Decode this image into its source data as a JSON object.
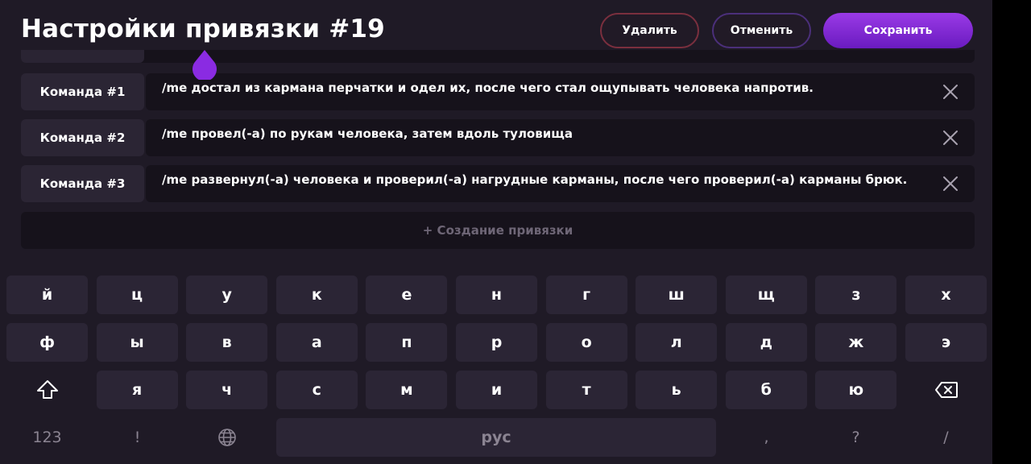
{
  "header": {
    "title": "Настройки привязки #19",
    "delete_label": "Удалить",
    "cancel_label": "Отменить",
    "save_label": "Сохранить"
  },
  "commands": [
    {
      "label": "Команда #1",
      "text": "/me достал из кармана перчатки и одел их, после чего стал ощупывать человека напротив."
    },
    {
      "label": "Команда #2",
      "text": "/me провел(-а) по рукам человека, затем вдоль туловища"
    },
    {
      "label": "Команда #3",
      "text": "/me развернул(-а) человека и проверил(-а) нагрудные карманы, после чего проверил(-а) карманы брюк."
    }
  ],
  "create_label": "+ Создание привязки",
  "keyboard": {
    "row1": [
      "й",
      "ц",
      "у",
      "к",
      "е",
      "н",
      "г",
      "ш",
      "щ",
      "з",
      "х"
    ],
    "row2": [
      "ф",
      "ы",
      "в",
      "а",
      "п",
      "р",
      "о",
      "л",
      "д",
      "ж",
      "э"
    ],
    "row3": [
      "я",
      "ч",
      "с",
      "м",
      "и",
      "т",
      "ь",
      "б",
      "ю"
    ],
    "numbers_label": "123",
    "exclaim_label": "!",
    "space_label": "рус",
    "comma_label": ",",
    "question_label": "?",
    "slash_label": "/"
  },
  "colors": {
    "background": "#1f1a26",
    "accent": "#8a2be2",
    "delete_border": "#7a2f3e",
    "cancel_border": "#4b2f7a"
  },
  "icons": {
    "remove": "close-icon",
    "shift": "shift-icon",
    "backspace": "backspace-icon",
    "language": "globe-icon",
    "cursor": "text-cursor-drop-icon"
  }
}
